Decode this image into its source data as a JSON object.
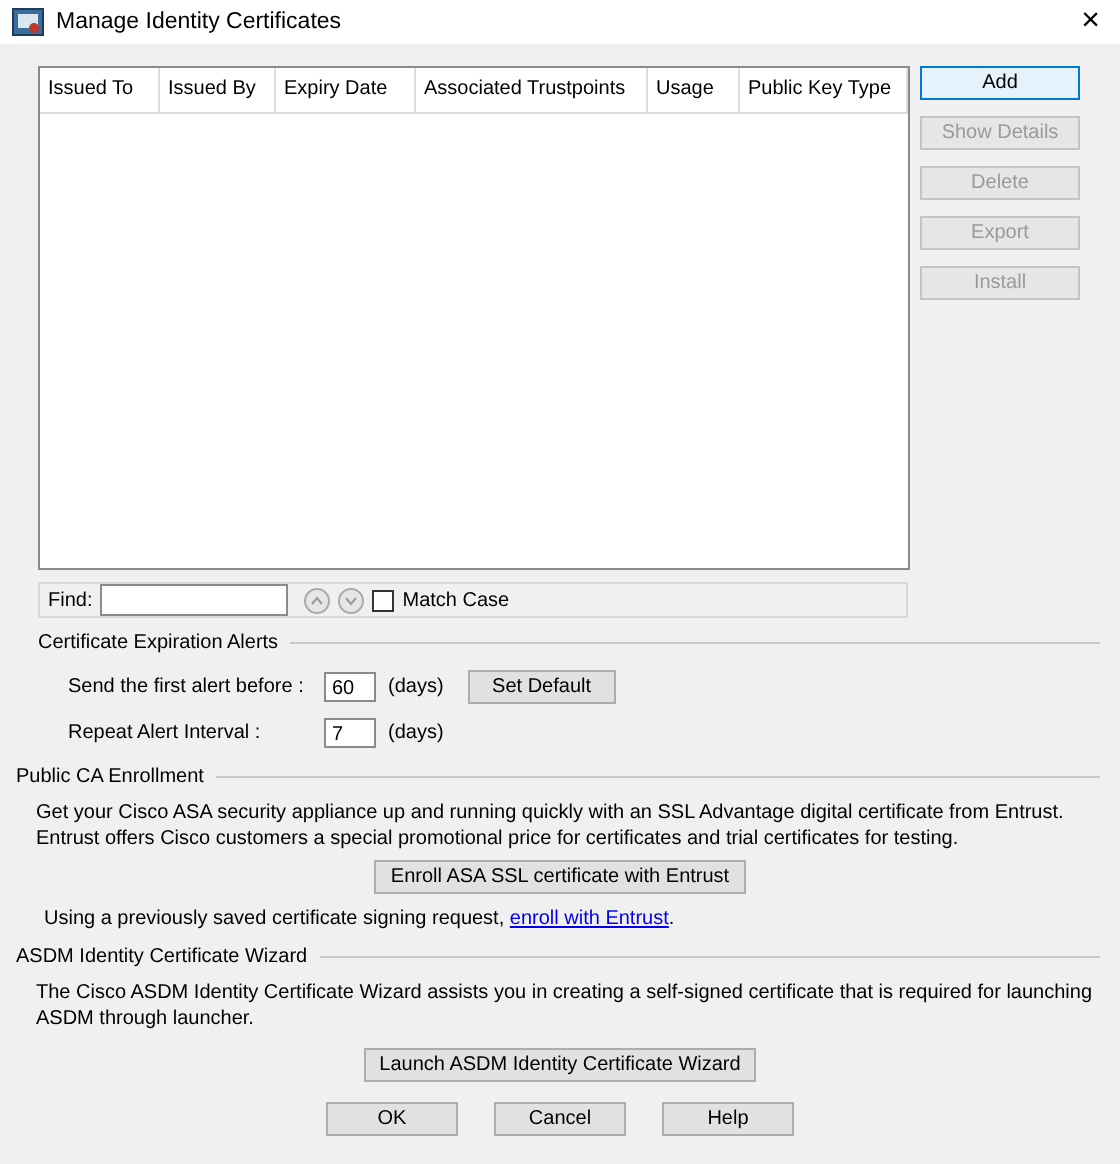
{
  "window": {
    "title": "Manage Identity Certificates",
    "close": "×"
  },
  "table": {
    "columns": [
      "Issued To",
      "Issued By",
      "Expiry Date",
      "Associated Trustpoints",
      "Usage",
      "Public Key Type"
    ]
  },
  "side_buttons": [
    {
      "label": "Add",
      "disabled": false
    },
    {
      "label": "Show Details",
      "disabled": true
    },
    {
      "label": "Delete",
      "disabled": true
    },
    {
      "label": "Export",
      "disabled": true
    },
    {
      "label": "Install",
      "disabled": true
    }
  ],
  "find": {
    "label": "Find:",
    "match_case": {
      "label": "Match Case",
      "checked": false
    }
  },
  "expiration": {
    "title": "Certificate Expiration Alerts",
    "first_label": "Send the first alert before :",
    "first_value": "60",
    "first_unit": "(days)",
    "default_button": "Set Default",
    "repeat_label": "Repeat Alert Interval :",
    "repeat_value": "7",
    "repeat_unit": "(days)"
  },
  "public_ca": {
    "title": "Public CA Enrollment",
    "text": "Get your Cisco ASA security appliance up and running quickly with an SSL Advantage digital certificate from Entrust. Entrust offers Cisco customers a special promotional price for certificates and trial certificates for testing.",
    "button": "Enroll ASA SSL certificate with Entrust",
    "csr_text": "Using a previously saved certificate signing request,",
    "csr_link": "enroll with Entrust",
    "csr_end": "."
  },
  "wizard": {
    "title": "ASDM Identity Certificate Wizard",
    "text": "The Cisco ASDM Identity Certificate Wizard assists you in creating a self-signed certificate that is required for launching ASDM through launcher.",
    "button": "Launch ASDM Identity Certificate Wizard"
  },
  "footer_buttons": [
    "OK",
    "Cancel",
    "Help"
  ]
}
